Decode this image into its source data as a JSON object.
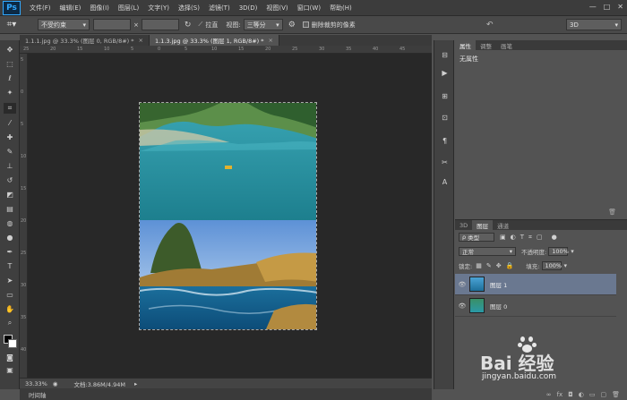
{
  "menu": {
    "logo": "Ps",
    "items": [
      "文件(F)",
      "编辑(E)",
      "图像(I)",
      "图层(L)",
      "文字(Y)",
      "选择(S)",
      "滤镜(T)",
      "3D(D)",
      "视图(V)",
      "窗口(W)",
      "帮助(H)"
    ],
    "win_controls": [
      "—",
      "□",
      "✕"
    ]
  },
  "options": {
    "ratio_select": "不受约束",
    "x_label": "×",
    "straighten_label": "拉直",
    "view_label": "视图:",
    "view_select": "三等分",
    "delete_crop_label": "删除裁剪的像素",
    "workspace": "3D"
  },
  "tabs": [
    {
      "label": "1.1.1.jpg @ 33.3% (图层 0, RGB/8#) *",
      "close": "×"
    },
    {
      "label": "1.1.3.jpg @ 33.3% (图层 1, RGB/8#) *",
      "close": "×"
    }
  ],
  "ruler": {
    "top_ticks": [
      "25",
      "20",
      "15",
      "10",
      "5",
      "0",
      "5",
      "10",
      "15",
      "20",
      "25",
      "30",
      "35",
      "40",
      "45"
    ],
    "left_ticks": [
      "5",
      "0",
      "5",
      "10",
      "15",
      "20",
      "25",
      "30",
      "35",
      "40"
    ]
  },
  "status": {
    "zoom": "33.33%",
    "doc": "文档:3.86M/4.94M",
    "timeline": "时间轴"
  },
  "properties": {
    "tabs": [
      "属性",
      "调整",
      "画笔"
    ],
    "content": "无属性"
  },
  "layers": {
    "tabs": [
      "3D",
      "图层",
      "通道"
    ],
    "filter": "类型",
    "blend_mode": "正常",
    "opacity_label": "不透明度:",
    "opacity": "100%",
    "lock_label": "锁定:",
    "fill_label": "填充:",
    "fill": "100%",
    "items": [
      {
        "name": "图层 1",
        "selected": true
      },
      {
        "name": "图层 0",
        "selected": false
      }
    ]
  },
  "watermark": {
    "brand": "Bai 经验",
    "url": "jingyan.baidu.com"
  },
  "colors": {
    "accent": "#31a8ff",
    "selected_layer": "#6a7890"
  }
}
